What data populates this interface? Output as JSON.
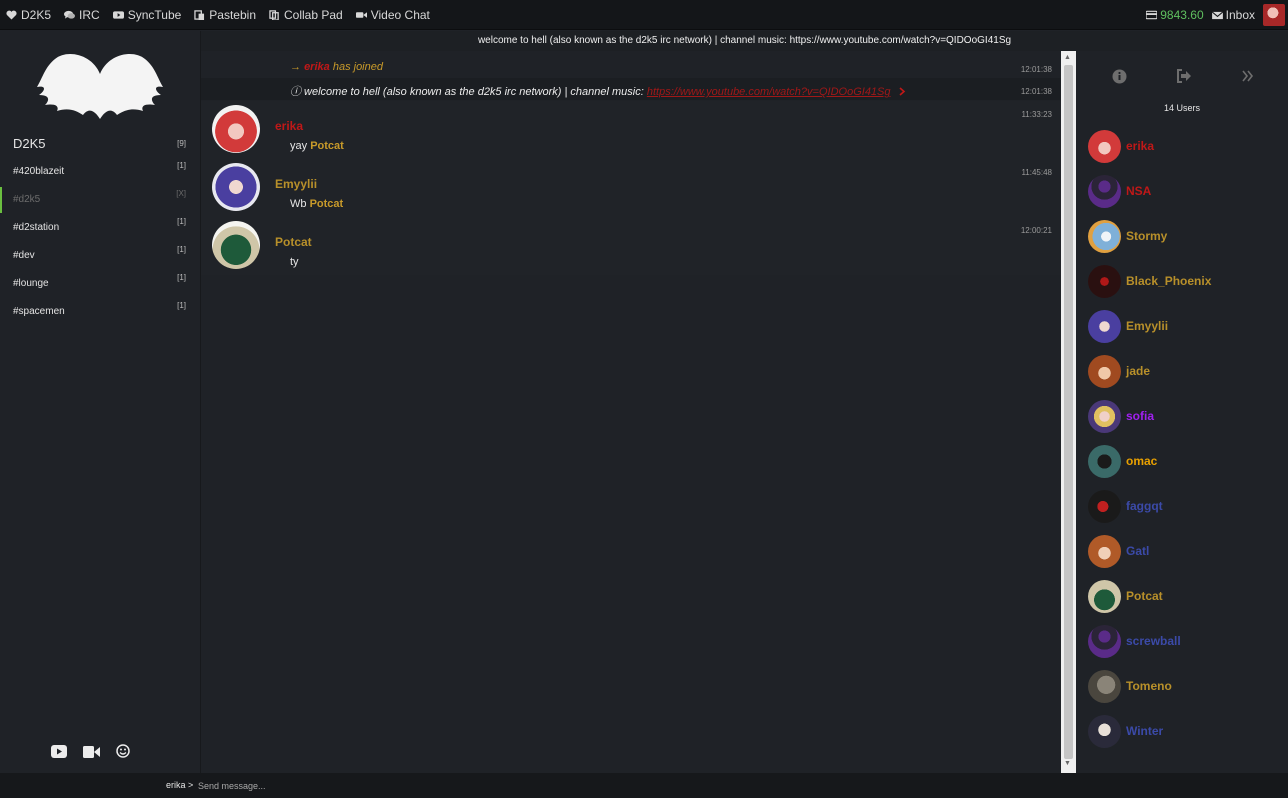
{
  "topbar": {
    "nav": [
      {
        "label": "D2K5",
        "icon": "heart-icon"
      },
      {
        "label": "IRC",
        "icon": "comments-icon"
      },
      {
        "label": "SyncTube",
        "icon": "youtube-icon"
      },
      {
        "label": "Pastebin",
        "icon": "paste-icon"
      },
      {
        "label": "Collab Pad",
        "icon": "copy-icon"
      },
      {
        "label": "Video Chat",
        "icon": "video-icon"
      }
    ],
    "balance": "9843.60",
    "inbox": "Inbox"
  },
  "sidebar": {
    "network": "D2K5",
    "network_count": "[9]",
    "channels": [
      {
        "name": "#420blazeit",
        "count": "[1]"
      },
      {
        "name": "#d2k5",
        "count": "[X]"
      },
      {
        "name": "#d2station",
        "count": "[1]"
      },
      {
        "name": "#dev",
        "count": "[1]"
      },
      {
        "name": "#lounge",
        "count": "[1]"
      },
      {
        "name": "#spacemen",
        "count": "[1]"
      }
    ]
  },
  "topic": "welcome to hell (also known as the d2k5 irc network) | channel music: https://www.youtube.com/watch?v=QIDOoGI41Sg",
  "messages": {
    "join": {
      "arrow": "→",
      "nick": "erika",
      "text": "has joined",
      "ts": "12:01:38"
    },
    "topic": {
      "prefix": "ⓘ welcome to hell (also known as the d2k5 irc network) | channel music:",
      "link": "https://www.youtube.com/watch?v=QIDOoGI41Sg",
      "ts": "12:01:38"
    },
    "chat": [
      {
        "nick": "erika",
        "prefix": "yay",
        "mention": "Potcat",
        "ts": "11:33:23"
      },
      {
        "nick": "Emyylii",
        "prefix": "Wb",
        "mention": "Potcat",
        "ts": "11:45:48"
      },
      {
        "nick": "Potcat",
        "prefix": "ty",
        "mention": "",
        "ts": "12:00:21"
      }
    ]
  },
  "users": {
    "count_label": "14 Users",
    "list": [
      {
        "name": "erika",
        "color": "#c01818"
      },
      {
        "name": "NSA",
        "color": "#c01818"
      },
      {
        "name": "Stormy",
        "color": "#b8902a"
      },
      {
        "name": "Black_Phoenix",
        "color": "#b8902a"
      },
      {
        "name": "Emyylii",
        "color": "#b8902a"
      },
      {
        "name": "jade",
        "color": "#b8902a"
      },
      {
        "name": "sofia",
        "color": "#a020f0"
      },
      {
        "name": "omac",
        "color": "#e8a000"
      },
      {
        "name": "faggqt",
        "color": "#3b4aa8"
      },
      {
        "name": "Gatl",
        "color": "#3b4aa8"
      },
      {
        "name": "Potcat",
        "color": "#b8902a"
      },
      {
        "name": "screwball",
        "color": "#3b4aa8"
      },
      {
        "name": "Tomeno",
        "color": "#b8902a"
      },
      {
        "name": "Winter",
        "color": "#3b4aa8"
      }
    ]
  },
  "input": {
    "prompt": "erika >",
    "placeholder": "Send message..."
  },
  "colors": {
    "accent_green": "#6abf40",
    "nick_red": "#c01818",
    "nick_gold": "#b8902a"
  }
}
